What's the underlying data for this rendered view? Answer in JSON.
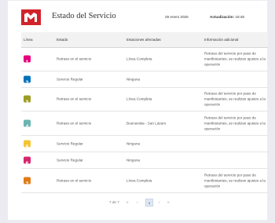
{
  "header": {
    "title": "Estado del Servicio",
    "date": "29 enero 2026",
    "updated_label": "Actualización:",
    "updated_time": "18:48"
  },
  "table": {
    "columns": [
      "Línea",
      "Estado",
      "Estaciones afectadas",
      "Información adicional"
    ],
    "rows": [
      {
        "line": "1",
        "color": "#e4007c",
        "status": "Retraso en el servicio",
        "stations": "Línea Completa",
        "info": "Retraso del servicio por paso de manifestantes, se realizan ajustes a la operación"
      },
      {
        "line": "2",
        "color": "#0072bc",
        "status": "Servicio Regular",
        "stations": "Ninguna",
        "info": ""
      },
      {
        "line": "3",
        "color": "#9c9c24",
        "status": "Retraso en el servicio",
        "stations": "Línea Completa",
        "info": "Retraso del servicio por paso de manifestantes, se realizan ajustes a la operación"
      },
      {
        "line": "4",
        "color": "#6bb5b2",
        "status": "Retraso en el servicio",
        "stations": "Buenavista - San Lázaro",
        "info": "Retraso del servicio por paso de manifestantes, se realizan ajustes a la operación"
      },
      {
        "line": "5",
        "color": "#f4c531",
        "status": "Servicio Regular",
        "stations": "Ninguna",
        "info": ""
      },
      {
        "line": "6",
        "color": "#d6266f",
        "status": "Servicio Regular",
        "stations": "Ninguna",
        "info": ""
      },
      {
        "line": "7",
        "color": "#e07a16",
        "status": "Retraso en el servicio",
        "stations": "Línea Completa",
        "info": "Retraso del servicio por paso de manifestantes, se realizan ajustes a la operación"
      }
    ]
  },
  "pagination": {
    "page_info": "7 de 7",
    "first": "«",
    "prev": "‹",
    "current": "1",
    "next": "›",
    "last": "»"
  }
}
